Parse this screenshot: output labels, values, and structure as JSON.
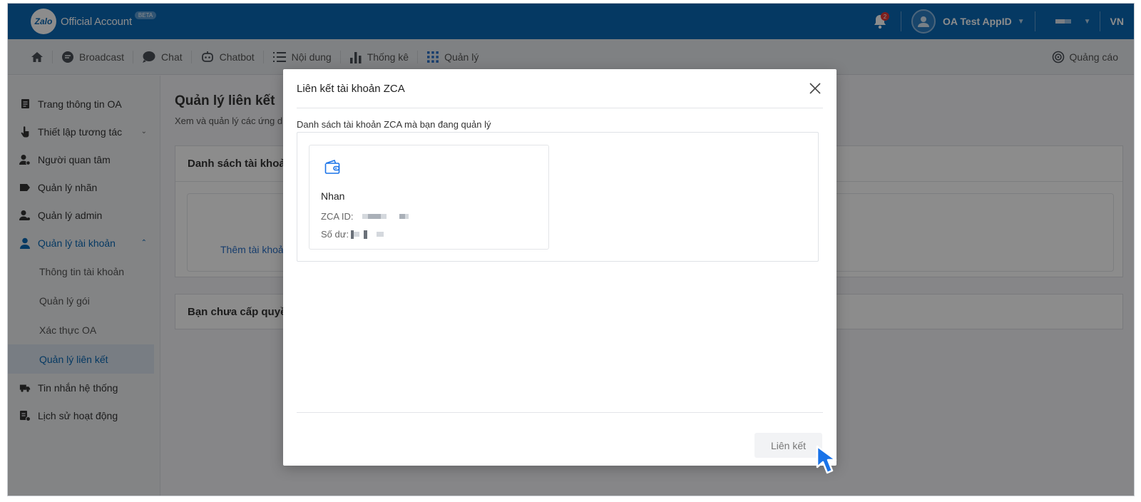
{
  "topbar": {
    "logo_badge": "Zalo",
    "logo_text": "Official Account",
    "beta": "BETA",
    "bell_count": "2",
    "account_name": "OA Test AppID",
    "lang": "VN"
  },
  "nav": {
    "items": [
      {
        "label": "Broadcast",
        "icon": "broadcast-icon"
      },
      {
        "label": "Chat",
        "icon": "chat-icon"
      },
      {
        "label": "Chatbot",
        "icon": "chatbot-icon"
      },
      {
        "label": "Nội dung",
        "icon": "list-icon"
      },
      {
        "label": "Thống kê",
        "icon": "bar-chart-icon"
      },
      {
        "label": "Quản lý",
        "icon": "grid-icon"
      }
    ],
    "ads_label": "Quảng cáo"
  },
  "sidebar": {
    "items": [
      {
        "label": "Trang thông tin OA"
      },
      {
        "label": "Thiết lập tương tác"
      },
      {
        "label": "Người quan tâm"
      },
      {
        "label": "Quản lý nhãn"
      },
      {
        "label": "Quản lý admin"
      },
      {
        "label": "Quản lý tài khoản"
      },
      {
        "label": "Tin nhắn hệ thống"
      },
      {
        "label": "Lịch sử hoạt động"
      }
    ],
    "sub_items": [
      {
        "label": "Thông tin tài khoản"
      },
      {
        "label": "Quản lý gói"
      },
      {
        "label": "Xác thực OA"
      },
      {
        "label": "Quản lý liên kết"
      }
    ]
  },
  "main": {
    "title": "Quản lý liên kết",
    "subtitle": "Xem và quản lý các ứng d",
    "card1_title": "Danh sách tài khoả",
    "add_link": "Thêm tài khoả",
    "card2_title": "Bạn chưa cấp quyền"
  },
  "modal": {
    "title": "Liên kết tài khoản ZCA",
    "list_label": "Danh sách tài khoản ZCA mà bạn đang quản lý",
    "account": {
      "name": "Nhan",
      "id_label": "ZCA ID:",
      "balance_label": "Số dư:"
    },
    "link_button": "Liên kết"
  },
  "colors": {
    "brand": "#0a68b4",
    "link": "#2a70c7",
    "cursor": "#1a73e8"
  }
}
